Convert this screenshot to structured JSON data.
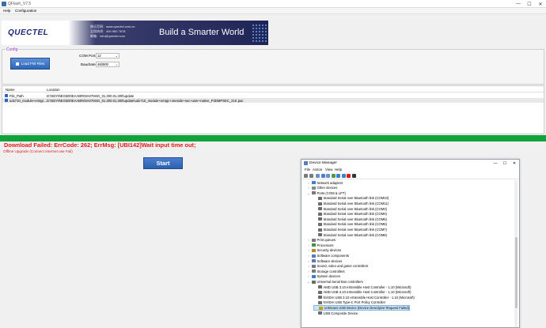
{
  "window": {
    "title": "QFlash_V7.5",
    "controls": [
      "—",
      "☐",
      "✕"
    ]
  },
  "menu": {
    "help": "Help",
    "configuration": "Configuration"
  },
  "banner": {
    "logo": "QUECTEL",
    "contact_lines": [
      "移远官网：www.quectel.com.cn",
      "全国热线：400 960 7678",
      "邮箱：info@quectel.com"
    ],
    "slogan": "Build a Smarter World"
  },
  "config": {
    "legend": "Config",
    "load_button": "Load FW Files",
    "com_port_label": "COM Port:",
    "com_port_value": "12",
    "baudrate_label": "Baudrate:",
    "baudrate_value": "460800"
  },
  "file_list": {
    "columns": [
      "Name",
      "Location"
    ],
    "rows": [
      {
        "name": "File_Path",
        "location": "D:\\NDY8\\EG500\\EAABR03A07M4G_01.300.01.300\\update",
        "selected": false
      },
      {
        "name": "udx710_module+emtgc...",
        "location": "D:\\NDY8\\EG500\\EAABR03A07M4G_01.300.01.300\\update\\udx710_module+emtgc+oneside+sec+user+native_P2DMPSEC_21K.pac",
        "selected": true
      }
    ]
  },
  "status": {
    "error": "Download Failed: ErrCode: 262; ErrMsg: [UBI142]Wait input time out;",
    "status_line": "Offline Upgrade (Connect Internet use Fail)"
  },
  "start_button": "Start",
  "device_manager": {
    "title": "Device Manager",
    "menu": [
      "File",
      "Action",
      "View",
      "Help"
    ],
    "toolbar_icons": [
      "back-icon",
      "forward-icon",
      "properties-icon",
      "help-icon",
      "scan-icon",
      "monitor-icon",
      "update-driver-icon",
      "uninstall-icon",
      "disable-icon",
      "download-icon"
    ],
    "tree": [
      {
        "label": "Network adapters",
        "level": 1,
        "expander": "›",
        "color": "#3d7fcf"
      },
      {
        "label": "Other devices",
        "level": 1,
        "expander": "›",
        "color": "#8a8a8a"
      },
      {
        "label": "Ports (COM & LPT)",
        "level": 1,
        "expander": "⌄",
        "color": "#7a7a7a"
      },
      {
        "label": "Standard Serial over Bluetooth link (COM10)",
        "level": 2,
        "expander": "",
        "color": "#6d6d6d"
      },
      {
        "label": "Standard Serial over Bluetooth link (COM11)",
        "level": 2,
        "expander": "",
        "color": "#6d6d6d"
      },
      {
        "label": "Standard Serial over Bluetooth link (COM3)",
        "level": 2,
        "expander": "",
        "color": "#6d6d6d"
      },
      {
        "label": "Standard Serial over Bluetooth link (COM4)",
        "level": 2,
        "expander": "",
        "color": "#6d6d6d"
      },
      {
        "label": "Standard Serial over Bluetooth link (COM5)",
        "level": 2,
        "expander": "",
        "color": "#6d6d6d"
      },
      {
        "label": "Standard Serial over Bluetooth link (COM6)",
        "level": 2,
        "expander": "",
        "color": "#6d6d6d"
      },
      {
        "label": "Standard Serial over Bluetooth link (COM7)",
        "level": 2,
        "expander": "",
        "color": "#6d6d6d"
      },
      {
        "label": "Standard Serial over Bluetooth link (COM8)",
        "level": 2,
        "expander": "",
        "color": "#6d6d6d"
      },
      {
        "label": "Print queues",
        "level": 1,
        "expander": "›",
        "color": "#7a7a7a"
      },
      {
        "label": "Processors",
        "level": 1,
        "expander": "›",
        "color": "#4a8f4a"
      },
      {
        "label": "Security devices",
        "level": 1,
        "expander": "›",
        "color": "#b08a2e"
      },
      {
        "label": "Software components",
        "level": 1,
        "expander": "›",
        "color": "#5a7ab5"
      },
      {
        "label": "Software devices",
        "level": 1,
        "expander": "›",
        "color": "#5a7ab5"
      },
      {
        "label": "Sound, video and game controllers",
        "level": 1,
        "expander": "›",
        "color": "#7a7a7a"
      },
      {
        "label": "Storage controllers",
        "level": 1,
        "expander": "›",
        "color": "#7a7a7a"
      },
      {
        "label": "System devices",
        "level": 1,
        "expander": "›",
        "color": "#3d7fcf"
      },
      {
        "label": "Universal Serial Bus controllers",
        "level": 1,
        "expander": "⌄",
        "color": "#6d6d6d"
      },
      {
        "label": "AMD USB 3.10 eXtensible Host Controller - 1.10 (Microsoft)",
        "level": 2,
        "expander": "",
        "color": "#6d6d6d"
      },
      {
        "label": "AMD USB 3.10 eXtensible Host Controller - 1.10 (Microsoft)",
        "level": 2,
        "expander": "",
        "color": "#6d6d6d"
      },
      {
        "label": "NVIDIA USB 3.10 eXtensible Host Controller - 1.10 (Microsoft)",
        "level": 2,
        "expander": "",
        "color": "#6d6d6d"
      },
      {
        "label": "NVIDIA USB Type-C Port Policy Controller",
        "level": 2,
        "expander": "",
        "color": "#6d6d6d"
      },
      {
        "label": "Unknown USB Device (Device Descriptor Request Failed)",
        "level": 2,
        "expander": "",
        "color": "#c9a200",
        "highlight": true
      },
      {
        "label": "USB Composite Device",
        "level": 2,
        "expander": "",
        "color": "#6d6d6d"
      }
    ]
  }
}
